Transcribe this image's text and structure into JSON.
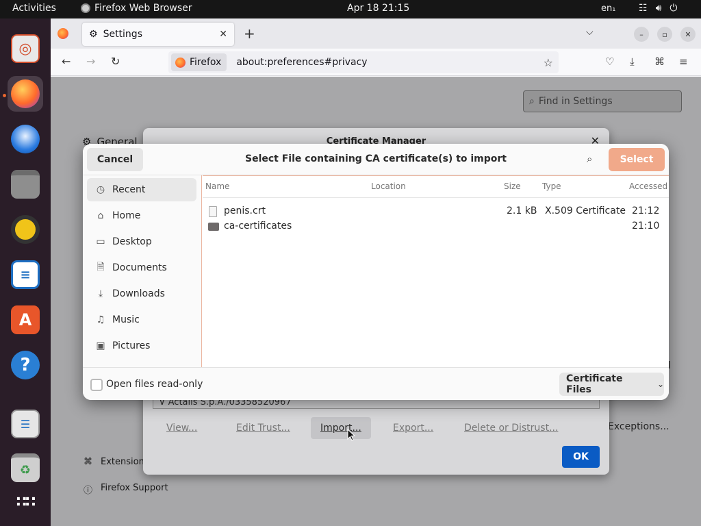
{
  "topbar": {
    "activities": "Activities",
    "app_name": "Firefox Web Browser",
    "clock": "Apr 18  21:15",
    "lang": "en₁"
  },
  "dock": {
    "items": [
      "help-icon"
    ]
  },
  "browser": {
    "tab_title": "Settings",
    "url_identity": "Firefox",
    "url": "about:preferences#privacy"
  },
  "settings_page": {
    "find_placeholder": "Find in Settings",
    "side_general": "General",
    "side_extensions": "Extensions",
    "side_support": "Firefox Support",
    "all_text": "ll",
    "exceptions": "Exceptions..."
  },
  "cert_manager": {
    "title": "Certificate Manager",
    "row_text": "∨ Actalis S.p.A./03358520967",
    "buttons": {
      "view": "View...",
      "edit_trust": "Edit Trust...",
      "import": "Import...",
      "export": "Export...",
      "delete": "Delete or Distrust..."
    },
    "ok": "OK"
  },
  "chooser": {
    "cancel": "Cancel",
    "title": "Select File containing CA certificate(s) to import",
    "select": "Select",
    "places": [
      {
        "label": "Recent",
        "icon": "clock-icon"
      },
      {
        "label": "Home",
        "icon": "home-icon"
      },
      {
        "label": "Desktop",
        "icon": "desktop-icon"
      },
      {
        "label": "Documents",
        "icon": "document-icon"
      },
      {
        "label": "Downloads",
        "icon": "download-icon"
      },
      {
        "label": "Music",
        "icon": "music-icon"
      },
      {
        "label": "Pictures",
        "icon": "picture-icon"
      }
    ],
    "columns": {
      "name": "Name",
      "location": "Location",
      "size": "Size",
      "type": "Type",
      "accessed": "Accessed"
    },
    "files": [
      {
        "name": "penis.crt",
        "size": "2.1 kB",
        "type": "X.509 Certificate",
        "accessed": "21:12",
        "kind": "file"
      },
      {
        "name": "ca-certificates",
        "size": "",
        "type": "",
        "accessed": "21:10",
        "kind": "folder"
      }
    ],
    "read_only_label": "Open files read-only",
    "filter": "Certificate Files"
  }
}
